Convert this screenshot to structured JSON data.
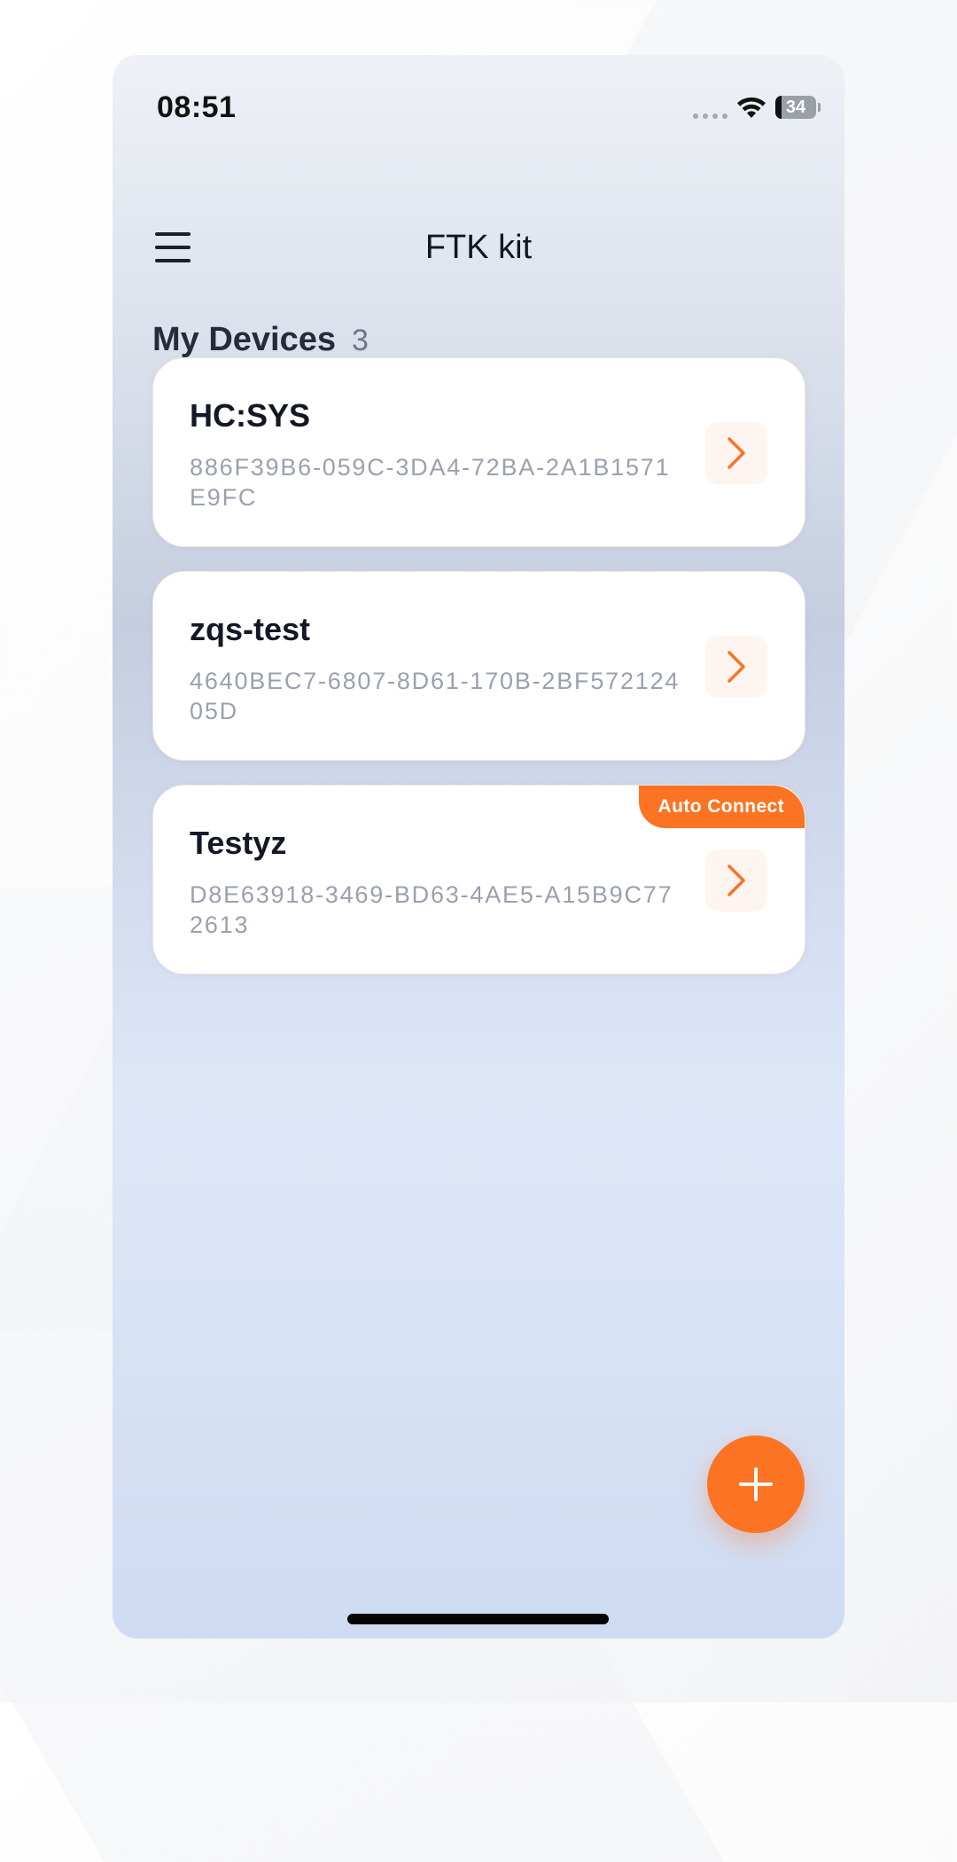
{
  "status_bar": {
    "time": "08:51",
    "battery": "34"
  },
  "header": {
    "title": "FTK kit",
    "menu_icon": "hamburger-menu-icon"
  },
  "devices_section": {
    "title": "My Devices",
    "count": "3"
  },
  "devices": [
    {
      "name": "HC:SYS",
      "uuid": "886F39B6-059C-3DA4-72BA-2A1B1571E9FC",
      "badge": null
    },
    {
      "name": "zqs-test",
      "uuid": "4640BEC7-6807-8D61-170B-2BF57212405D",
      "badge": null
    },
    {
      "name": "Testyz",
      "uuid": "D8E63918-3469-BD63-4AE5-A15B9C772613",
      "badge": "Auto Connect"
    }
  ],
  "colors": {
    "accent": "#fb7323",
    "accent_soft": "#fff5f0",
    "title_text": "#141826",
    "uuid_text": "#9aa0ae"
  },
  "fab": {
    "icon": "plus-icon"
  }
}
